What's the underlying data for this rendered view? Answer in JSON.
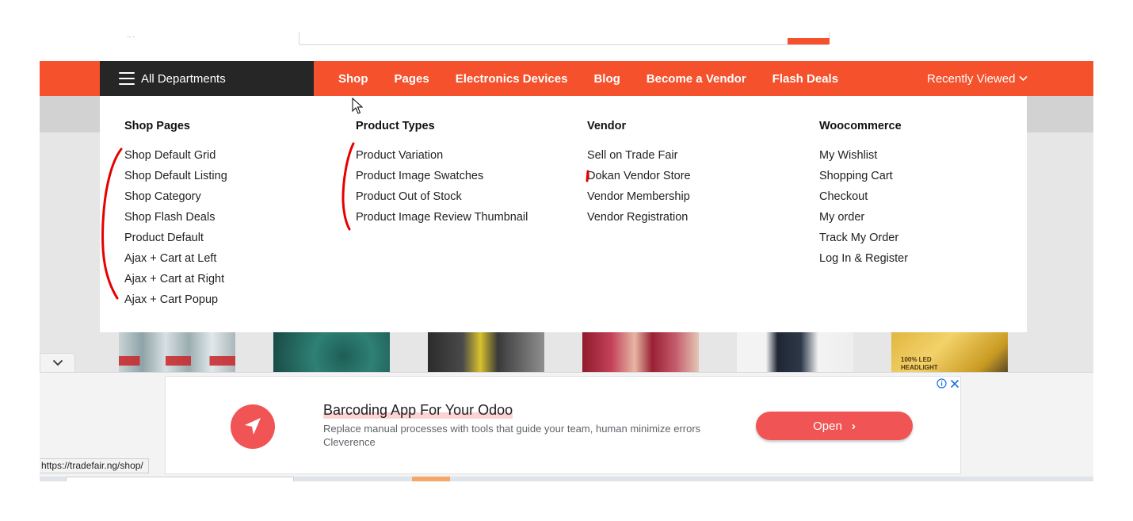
{
  "navbar": {
    "all_departments": "All Departments",
    "links": [
      "Shop",
      "Pages",
      "Electronics Devices",
      "Blog",
      "Become a Vendor",
      "Flash Deals"
    ],
    "recently_viewed": "Recently Viewed"
  },
  "mega_menu": {
    "columns": [
      {
        "title": "Shop Pages",
        "items": [
          "Shop Default Grid",
          "Shop Default Listing",
          "Shop Category",
          "Shop Flash Deals",
          "Product Default",
          "Ajax + Cart at Left",
          "Ajax + Cart at Right",
          "Ajax + Cart Popup"
        ]
      },
      {
        "title": "Product Types",
        "items": [
          "Product Variation",
          "Product Image Swatches",
          "Product Out of Stock",
          "Product Image Review Thumbnail"
        ]
      },
      {
        "title": "Vendor",
        "items": [
          "Sell on Trade Fair",
          "Dokan Vendor Store",
          "Vendor Membership",
          "Vendor Registration"
        ]
      },
      {
        "title": "Woocommerce",
        "items": [
          "My Wishlist",
          "Shopping Cart",
          "Checkout",
          "My order",
          "Track My Order",
          "Log In & Register"
        ]
      }
    ]
  },
  "products": {
    "thumb_6_text": "100% LED HEADLIGHT"
  },
  "ad": {
    "title": "Barcoding App For Your Odoo",
    "description": "Replace manual processes with tools that guide your team, human minimize errors",
    "source": "Cleverence",
    "cta": "Open",
    "icons": [
      "info-icon",
      "close-icon"
    ]
  },
  "status_bar": {
    "url": "https://tradefair.ng/shop/"
  },
  "colors": {
    "brand_orange": "#f4512c",
    "dept_dark": "#262626",
    "ad_red": "#f05454",
    "annotation_red": "#e60000"
  }
}
